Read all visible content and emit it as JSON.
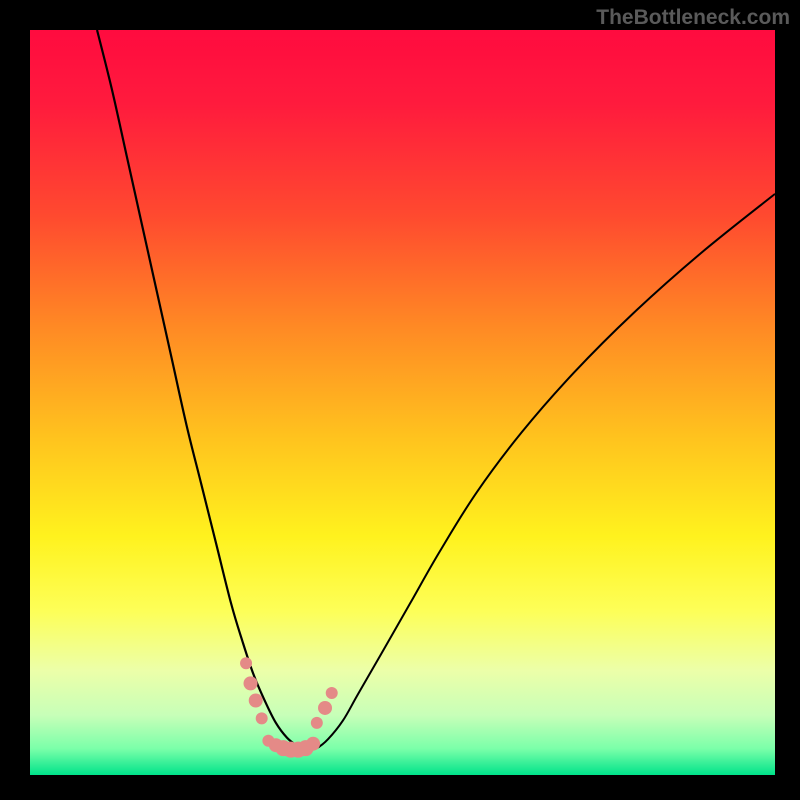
{
  "watermark": "TheBottleneck.com",
  "colors": {
    "frame": "#000000",
    "gradient_stops": [
      {
        "offset": 0.0,
        "color": "#ff0b3f"
      },
      {
        "offset": 0.1,
        "color": "#ff1b3d"
      },
      {
        "offset": 0.25,
        "color": "#ff4a2f"
      },
      {
        "offset": 0.4,
        "color": "#ff8a24"
      },
      {
        "offset": 0.55,
        "color": "#ffc41e"
      },
      {
        "offset": 0.68,
        "color": "#fff21e"
      },
      {
        "offset": 0.78,
        "color": "#fdff58"
      },
      {
        "offset": 0.86,
        "color": "#ecffa9"
      },
      {
        "offset": 0.92,
        "color": "#c7ffb8"
      },
      {
        "offset": 0.965,
        "color": "#7affa9"
      },
      {
        "offset": 1.0,
        "color": "#00e38a"
      }
    ],
    "curve": "#000000",
    "marker_fill": "#e48a87",
    "marker_stroke": "#c96d6a"
  },
  "chart_data": {
    "type": "line",
    "title": "",
    "xlabel": "",
    "ylabel": "",
    "xlim": [
      0,
      100
    ],
    "ylim": [
      0,
      100
    ],
    "grid": false,
    "legend": false,
    "series": [
      {
        "name": "left-curve",
        "x": [
          9,
          11,
          13,
          15,
          17,
          19,
          21,
          23,
          25,
          27,
          28.5,
          30,
          31.5,
          33,
          34.5,
          36,
          37
        ],
        "y": [
          100,
          92,
          83,
          74,
          65,
          56,
          47,
          39,
          31,
          23,
          18,
          13.5,
          10,
          7,
          5,
          3.8,
          3.2
        ]
      },
      {
        "name": "right-curve",
        "x": [
          37,
          38.5,
          40,
          42,
          44,
          47,
          51,
          55,
          60,
          66,
          73,
          81,
          90,
          100
        ],
        "y": [
          3.2,
          3.6,
          4.8,
          7.3,
          10.8,
          16,
          23,
          30,
          38,
          46,
          54,
          62,
          70,
          78
        ]
      }
    ],
    "bottom_markers": {
      "name": "markers-near-minimum",
      "left_cluster": [
        {
          "x": 29.0,
          "y": 15.0,
          "r": 6
        },
        {
          "x": 29.6,
          "y": 12.3,
          "r": 7
        },
        {
          "x": 30.3,
          "y": 10.0,
          "r": 7
        },
        {
          "x": 31.1,
          "y": 7.6,
          "r": 6
        }
      ],
      "right_cluster": [
        {
          "x": 38.5,
          "y": 7.0,
          "r": 6
        },
        {
          "x": 39.6,
          "y": 9.0,
          "r": 7
        },
        {
          "x": 40.5,
          "y": 11.0,
          "r": 6
        }
      ],
      "flat_run": [
        {
          "x": 32.0,
          "y": 4.6,
          "r": 6
        },
        {
          "x": 33.0,
          "y": 4.0,
          "r": 7
        },
        {
          "x": 34.0,
          "y": 3.6,
          "r": 8
        },
        {
          "x": 35.0,
          "y": 3.4,
          "r": 8
        },
        {
          "x": 36.0,
          "y": 3.4,
          "r": 8
        },
        {
          "x": 37.0,
          "y": 3.6,
          "r": 8
        },
        {
          "x": 38.0,
          "y": 4.2,
          "r": 7
        }
      ]
    }
  }
}
